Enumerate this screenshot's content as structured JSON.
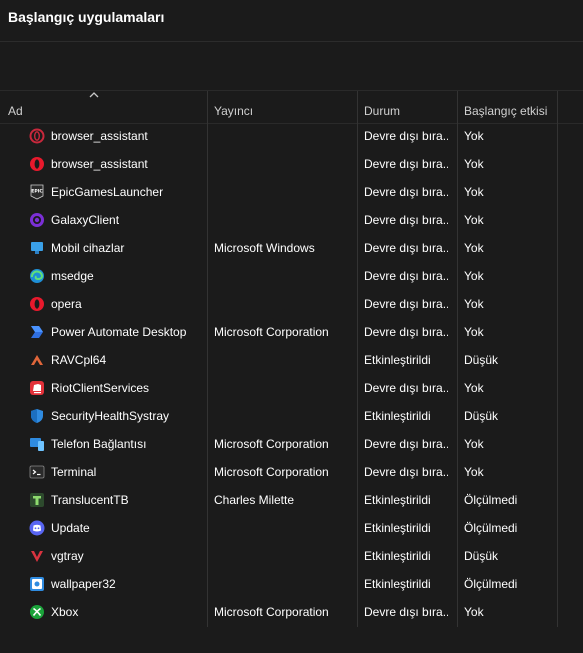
{
  "title": "Başlangıç uygulamaları",
  "columns": {
    "name": "Ad",
    "publisher": "Yayıncı",
    "status": "Durum",
    "impact": "Başlangıç etkisi"
  },
  "colors": {
    "background": "#1b1b1b",
    "text": "#ffffff",
    "header_text": "#d0d0d0",
    "grid": "#333333"
  },
  "rows": [
    {
      "icon": "opera-gx-icon",
      "name": "browser_assistant",
      "publisher": "",
      "status": "Devre dışı bıra...",
      "impact": "Yok"
    },
    {
      "icon": "opera-icon",
      "name": "browser_assistant",
      "publisher": "",
      "status": "Devre dışı bıra...",
      "impact": "Yok"
    },
    {
      "icon": "epic-games-icon",
      "name": "EpicGamesLauncher",
      "publisher": "",
      "status": "Devre dışı bıra...",
      "impact": "Yok"
    },
    {
      "icon": "galaxy-icon",
      "name": "GalaxyClient",
      "publisher": "",
      "status": "Devre dışı bıra...",
      "impact": "Yok"
    },
    {
      "icon": "mobile-devices-icon",
      "name": "Mobil cihazlar",
      "publisher": "Microsoft Windows",
      "status": "Devre dışı bıra...",
      "impact": "Yok"
    },
    {
      "icon": "edge-icon",
      "name": "msedge",
      "publisher": "",
      "status": "Devre dışı bıra...",
      "impact": "Yok"
    },
    {
      "icon": "opera-icon",
      "name": "opera",
      "publisher": "",
      "status": "Devre dışı bıra...",
      "impact": "Yok"
    },
    {
      "icon": "power-automate-icon",
      "name": "Power Automate Desktop",
      "publisher": "Microsoft Corporation",
      "status": "Devre dışı bıra...",
      "impact": "Yok"
    },
    {
      "icon": "rav-icon",
      "name": "RAVCpl64",
      "publisher": "",
      "status": "Etkinleştirildi",
      "impact": "Düşük"
    },
    {
      "icon": "riot-icon",
      "name": "RiotClientServices",
      "publisher": "",
      "status": "Devre dışı bıra...",
      "impact": "Yok"
    },
    {
      "icon": "security-shield-icon",
      "name": "SecurityHealthSystray",
      "publisher": "",
      "status": "Etkinleştirildi",
      "impact": "Düşük"
    },
    {
      "icon": "phone-link-icon",
      "name": "Telefon Bağlantısı",
      "publisher": "Microsoft Corporation",
      "status": "Devre dışı bıra...",
      "impact": "Yok"
    },
    {
      "icon": "terminal-icon",
      "name": "Terminal",
      "publisher": "Microsoft Corporation",
      "status": "Devre dışı bıra...",
      "impact": "Yok"
    },
    {
      "icon": "translucenttb-icon",
      "name": "TranslucentTB",
      "publisher": "Charles Milette",
      "status": "Etkinleştirildi",
      "impact": "Ölçülmedi"
    },
    {
      "icon": "discord-icon",
      "name": "Update",
      "publisher": "",
      "status": "Etkinleştirildi",
      "impact": "Ölçülmedi"
    },
    {
      "icon": "vgtray-icon",
      "name": "vgtray",
      "publisher": "",
      "status": "Etkinleştirildi",
      "impact": "Düşük"
    },
    {
      "icon": "wallpaper-icon",
      "name": "wallpaper32",
      "publisher": "",
      "status": "Etkinleştirildi",
      "impact": "Ölçülmedi"
    },
    {
      "icon": "xbox-icon",
      "name": "Xbox",
      "publisher": "Microsoft Corporation",
      "status": "Devre dışı bıra...",
      "impact": "Yok"
    }
  ]
}
